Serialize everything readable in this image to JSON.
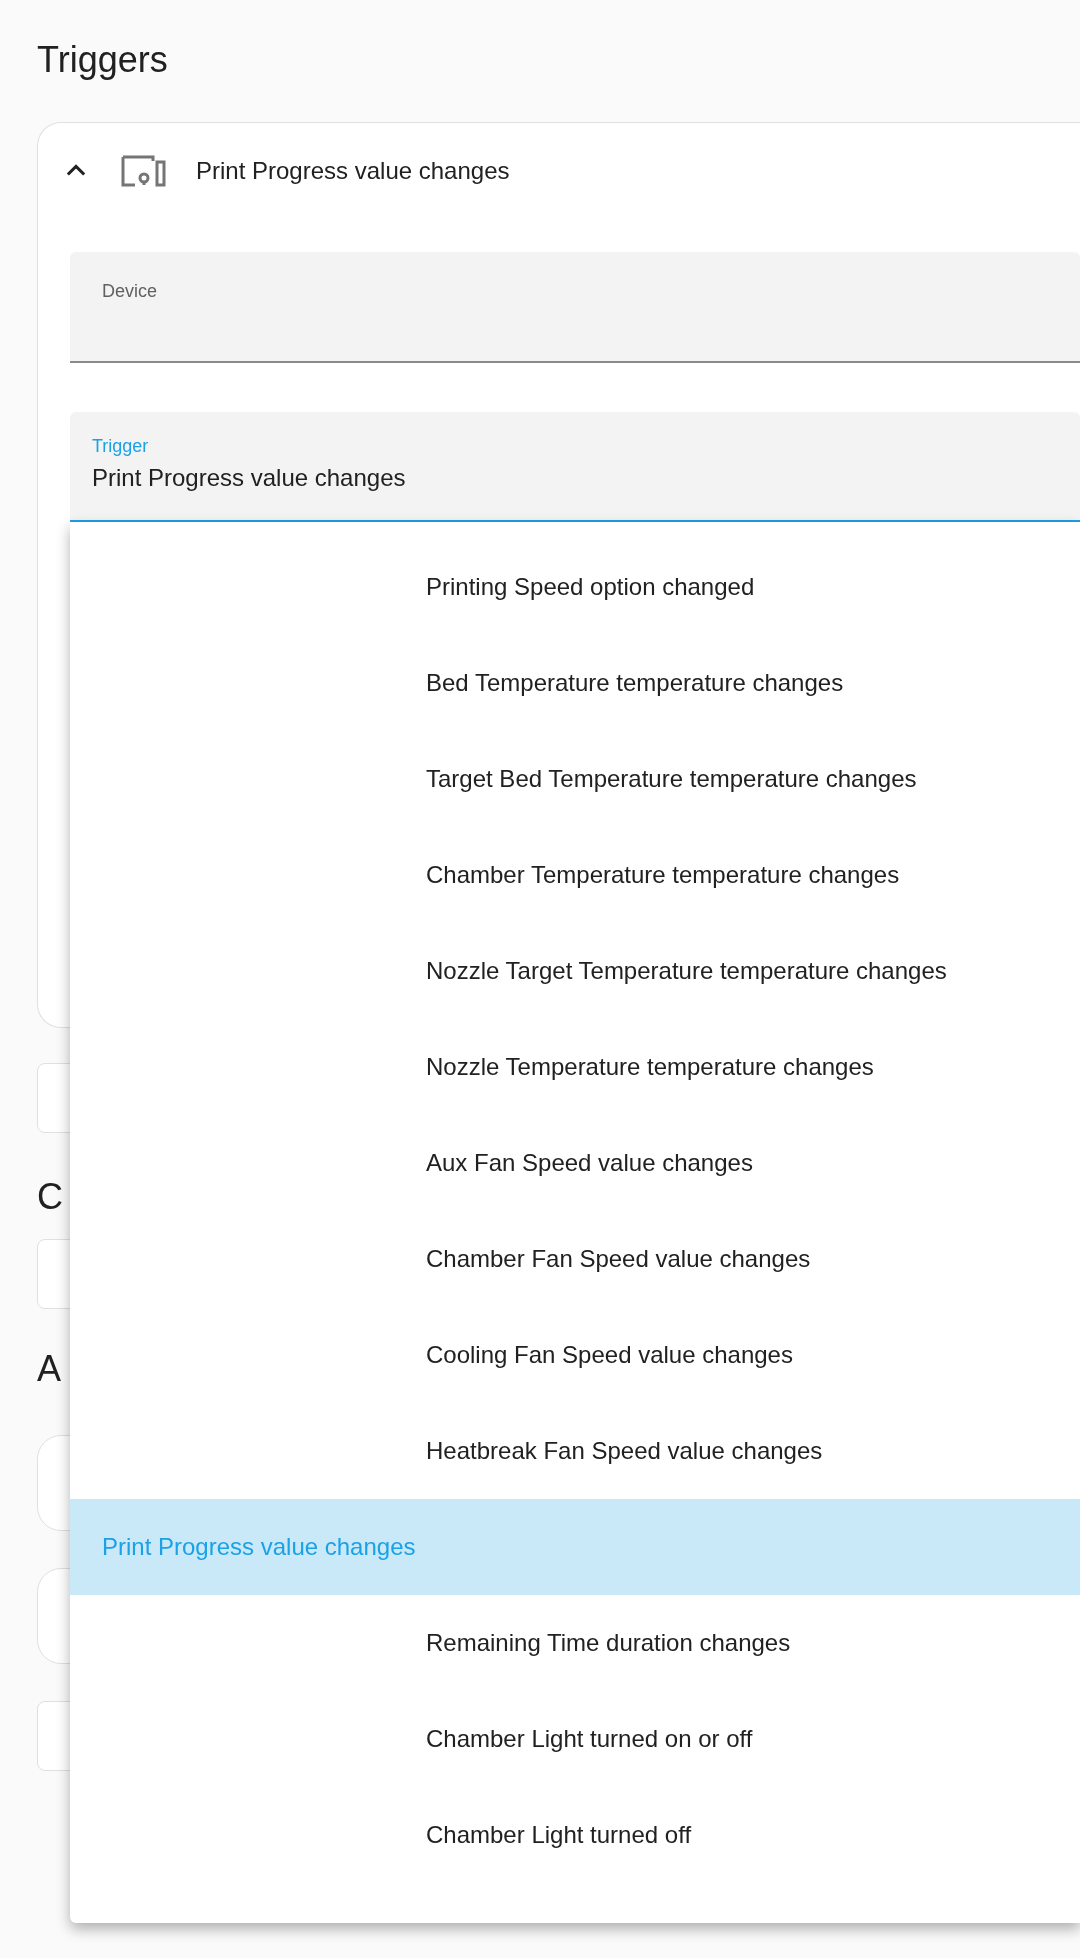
{
  "heading": "Triggers",
  "trigger_card": {
    "expanded": true,
    "title": "Print Progress value changes"
  },
  "device_field": {
    "label": "Device"
  },
  "trigger_field": {
    "label": "Trigger",
    "value": "Print Progress value changes"
  },
  "sections_behind": [
    "C",
    "A"
  ],
  "menu": {
    "items": [
      {
        "label": "Printing Speed option changed",
        "selected": false
      },
      {
        "label": "Bed Temperature temperature changes",
        "selected": false
      },
      {
        "label": "Target Bed Temperature temperature changes",
        "selected": false
      },
      {
        "label": "Chamber Temperature temperature changes",
        "selected": false
      },
      {
        "label": "Nozzle Target Temperature temperature changes",
        "selected": false
      },
      {
        "label": "Nozzle Temperature temperature changes",
        "selected": false
      },
      {
        "label": "Aux Fan Speed value changes",
        "selected": false
      },
      {
        "label": "Chamber Fan Speed value changes",
        "selected": false
      },
      {
        "label": "Cooling Fan Speed value changes",
        "selected": false
      },
      {
        "label": "Heatbreak Fan Speed value changes",
        "selected": false
      },
      {
        "label": "Print Progress value changes",
        "selected": true
      },
      {
        "label": "Remaining Time duration changes",
        "selected": false
      },
      {
        "label": "Chamber Light turned on or off",
        "selected": false
      },
      {
        "label": "Chamber Light turned off",
        "selected": false
      }
    ]
  }
}
